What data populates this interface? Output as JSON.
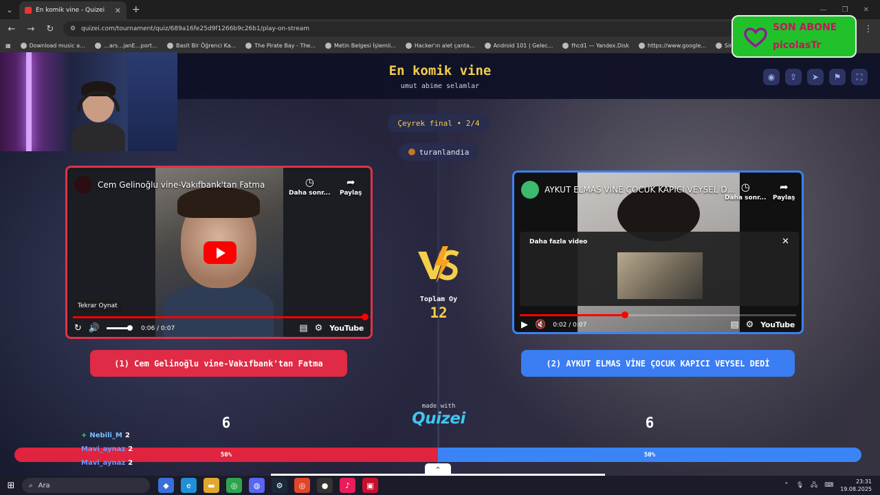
{
  "browser": {
    "tab_title": "En komik vine - Quizei",
    "url": "quizei.com/tournament/quiz/689a16fe25d9f1266b9c26b1/play-on-stream",
    "bookmarks": [
      "Download music a…",
      "…ars…janE…port…",
      "Basit Bir Öğrenci Ka...",
      "The Pirate Bay - The...",
      "Metin Belgesi İşlemli...",
      "Hacker'ın alet çanta...",
      "Android 101 | Gelec...",
      "fhcd1 — Yandex.Disk",
      "https://www.google...",
      "Simge Çizmek ve Ka..."
    ]
  },
  "quiz": {
    "title": "En komik vine",
    "subtitle": "umut abime selamlar",
    "round": "Çeyrek final • 2/4",
    "streamer": "turanlandia",
    "total_label": "Toplam Oy",
    "total_votes": "12",
    "made_with": "made with",
    "brand": "Quizei"
  },
  "left": {
    "video_title": "Cem Gelinoğlu vine-Vakıfbank'tan Fatma",
    "later_label": "Daha sonr...",
    "share_label": "Paylaş",
    "tooltip": "Tekrar Oynat",
    "time": "0:06 / 0:07",
    "progress": 1.0,
    "option_label": "(1) Cem Gelinoğlu vine-Vakıfbank'tan Fatma",
    "votes": "6",
    "percent": "50%",
    "share": 0.5,
    "color": "#e0233f"
  },
  "right": {
    "video_title": "AYKUT ELMAS VİNE ÇOCUK KAPICI VEYSEL D...",
    "later_label": "Daha sonr...",
    "share_label": "Paylaş",
    "more_videos": "Daha fazla video",
    "time": "0:02 / 0:07",
    "progress": 0.38,
    "option_label": "(2) AYKUT ELMAS VİNE ÇOCUK KAPICI VEYSEL DEDİ",
    "votes": "6",
    "percent": "50%",
    "share": 0.5,
    "color": "#3a84f6"
  },
  "chat": [
    {
      "name": "Nebili_M",
      "count": "2",
      "badge": "+"
    },
    {
      "name": "Mavi_aynaz",
      "count": "2",
      "badge": ""
    },
    {
      "name": "Mavi_aynaz",
      "count": "2",
      "badge": ""
    }
  ],
  "sub_widget": {
    "title": "SON ABONE",
    "name": "picolasTr"
  },
  "youtube_logo": "YouTube",
  "taskbar": {
    "search_placeholder": "Ara",
    "time": "23:31",
    "date": "19.08.2025"
  }
}
